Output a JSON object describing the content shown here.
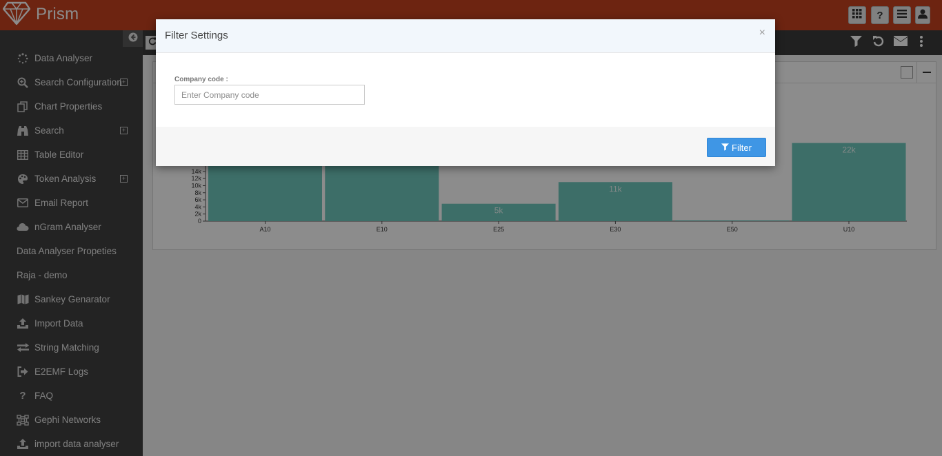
{
  "app": {
    "name": "Prism"
  },
  "header": {
    "buttons": [
      {
        "name": "apps-grid",
        "icon": "grid-icon",
        "label": ""
      },
      {
        "name": "help",
        "icon": "question-icon",
        "label": "?"
      },
      {
        "name": "menu",
        "icon": "hamburger-icon",
        "label": ""
      },
      {
        "name": "user",
        "icon": "user-icon",
        "label": ""
      }
    ]
  },
  "sidebar": {
    "items": [
      {
        "label": "Data Analyser",
        "icon": "spinner-icon",
        "expandable": false
      },
      {
        "label": "Search Configuration",
        "icon": "search-zoom-icon",
        "expandable": true
      },
      {
        "label": "Chart Properties",
        "icon": "copy-icon",
        "expandable": false
      },
      {
        "label": "Search",
        "icon": "binoculars-icon",
        "expandable": true
      },
      {
        "label": "Table Editor",
        "icon": "table-icon",
        "expandable": false
      },
      {
        "label": "Token Analysis",
        "icon": "palette-icon",
        "expandable": true
      },
      {
        "label": "Email Report",
        "icon": "envelope-icon",
        "expandable": false
      },
      {
        "label": "nGram Analyser",
        "icon": "cloud-icon",
        "expandable": false
      },
      {
        "label": "Data Analyser Propeties",
        "icon": "",
        "expandable": false
      },
      {
        "label": "Raja - demo",
        "icon": "",
        "expandable": false
      },
      {
        "label": "Sankey Genarator",
        "icon": "map-icon",
        "expandable": false
      },
      {
        "label": "Import Data",
        "icon": "upload-icon",
        "expandable": false
      },
      {
        "label": "String Matching",
        "icon": "exchange-icon",
        "expandable": false
      },
      {
        "label": "E2EMF Logs",
        "icon": "sign-out-icon",
        "expandable": false
      },
      {
        "label": "FAQ",
        "icon": "question-icon",
        "expandable": false
      },
      {
        "label": "Gephi Networks",
        "icon": "network-icon",
        "expandable": false
      },
      {
        "label": "import data analyser",
        "icon": "upload-icon",
        "expandable": false
      }
    ]
  },
  "toolbar": {
    "icons": [
      "filter-icon",
      "undo-icon",
      "envelope-icon",
      "more-vertical-icon"
    ]
  },
  "chart_data": {
    "type": "bar",
    "categories": [
      "A10",
      "E10",
      "E25",
      "E30",
      "E50",
      "U10"
    ],
    "values": [
      32000,
      32000,
      4900,
      11000,
      200,
      22000
    ],
    "value_labels": [
      "",
      "",
      "5k",
      "11k",
      "",
      "22k"
    ],
    "y_ticks": [
      "0",
      "2k",
      "4k",
      "6k",
      "8k",
      "10k",
      "12k",
      "14k"
    ],
    "bar_color": "#6fc8be"
  },
  "modal": {
    "title": "Filter Settings",
    "close_label": "×",
    "field_label": "Company code :",
    "field_placeholder": "Enter Company code",
    "field_value": "",
    "submit_label": "Filter"
  },
  "colors": {
    "header": "#c7421f",
    "sidebar": "#414141",
    "primary_button": "#3f96e5"
  }
}
